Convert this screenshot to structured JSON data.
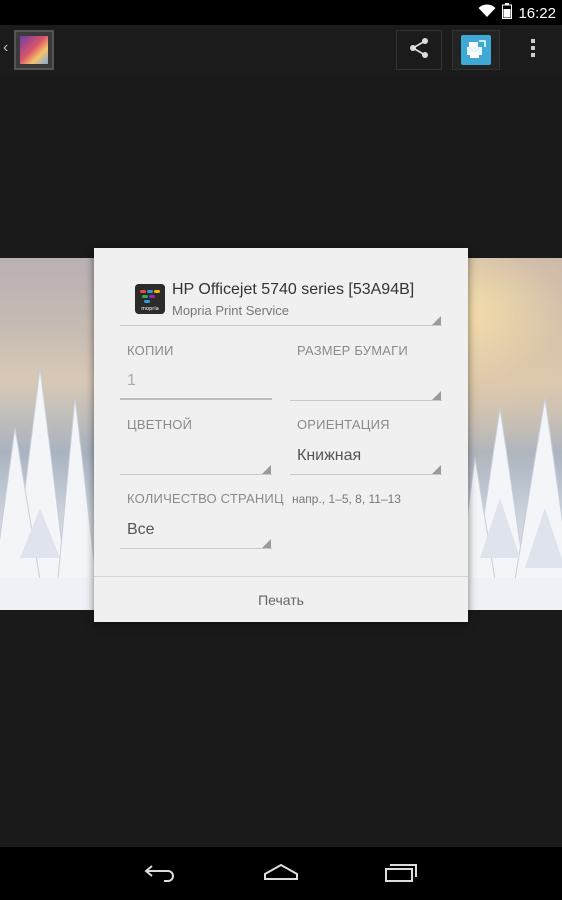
{
  "status_bar": {
    "time": "16:22",
    "icons": [
      "wifi-icon",
      "battery-icon"
    ]
  },
  "action_bar": {
    "up_caret": "‹",
    "thumbnail": "gallery-thumbnail",
    "actions": [
      "share-icon",
      "print-icon",
      "overflow-menu-icon"
    ]
  },
  "dialog": {
    "printer": {
      "name": "HP Officejet 5740 series [53A94B]",
      "service": "Mopria Print Service",
      "logo_text": "mopria"
    },
    "copies": {
      "label": "КОПИИ",
      "value": "1"
    },
    "paper_size": {
      "label": "РАЗМЕР БУМАГИ",
      "value": ""
    },
    "color": {
      "label": "ЦВЕТНОЙ",
      "value": ""
    },
    "orientation": {
      "label": "ОРИЕНТАЦИЯ",
      "value": "Книжная"
    },
    "pages": {
      "label": "КОЛИЧЕСТВО СТРАНИЦ",
      "value": "Все",
      "hint": "напр., 1–5, 8, 11–13"
    },
    "print_button": "Печать"
  },
  "nav_bar": {
    "buttons": [
      "back-icon",
      "home-icon",
      "recents-icon"
    ]
  },
  "colors": {
    "accent": "#3fa9d6",
    "dialog_bg": "#f0f0f0",
    "status_bar_bg": "#000000"
  }
}
